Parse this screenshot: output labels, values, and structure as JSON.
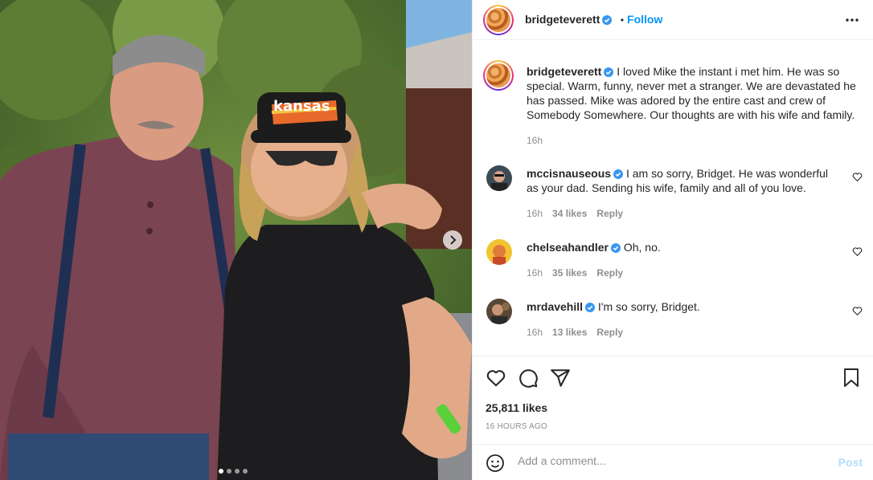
{
  "post": {
    "author": "bridgeteverett",
    "follow_label": "Follow",
    "dot_sep": "•",
    "caption_text": "I loved Mike the instant i met him. He was so special. Warm, funny, never met a stranger. We are devastated he has passed. Mike was adored by the entire cast and crew of Somebody Somewhere. Our thoughts are with his wife and family.",
    "caption_time": "16h",
    "likes": "25,811 likes",
    "time_ago": "16 HOURS AGO",
    "carousel": {
      "count": 4,
      "active_index": 1,
      "hat_text": "kansas"
    }
  },
  "comments": [
    {
      "user": "mccisnauseous",
      "text": "I am so sorry, Bridget. He was wonderful as your dad. Sending his wife, family and all of you love.",
      "time": "16h",
      "likes": "34 likes",
      "reply": "Reply"
    },
    {
      "user": "chelseahandler",
      "text": "Oh, no.",
      "time": "16h",
      "likes": "35 likes",
      "reply": "Reply"
    },
    {
      "user": "mrdavehill",
      "text": "I'm so sorry, Bridget.",
      "time": "16h",
      "likes": "13 likes",
      "reply": "Reply"
    }
  ],
  "comment_box": {
    "placeholder": "Add a comment...",
    "post_label": "Post"
  },
  "colors": {
    "link": "#0095f6",
    "verified": "#3897f0",
    "post_disabled": "#b2dffc",
    "muted": "#8e8e8e"
  },
  "icons": [
    "verified-badge-icon",
    "more-options-icon",
    "heart-icon",
    "comment-icon",
    "share-icon",
    "bookmark-icon",
    "emoji-icon",
    "chevron-right-icon"
  ]
}
